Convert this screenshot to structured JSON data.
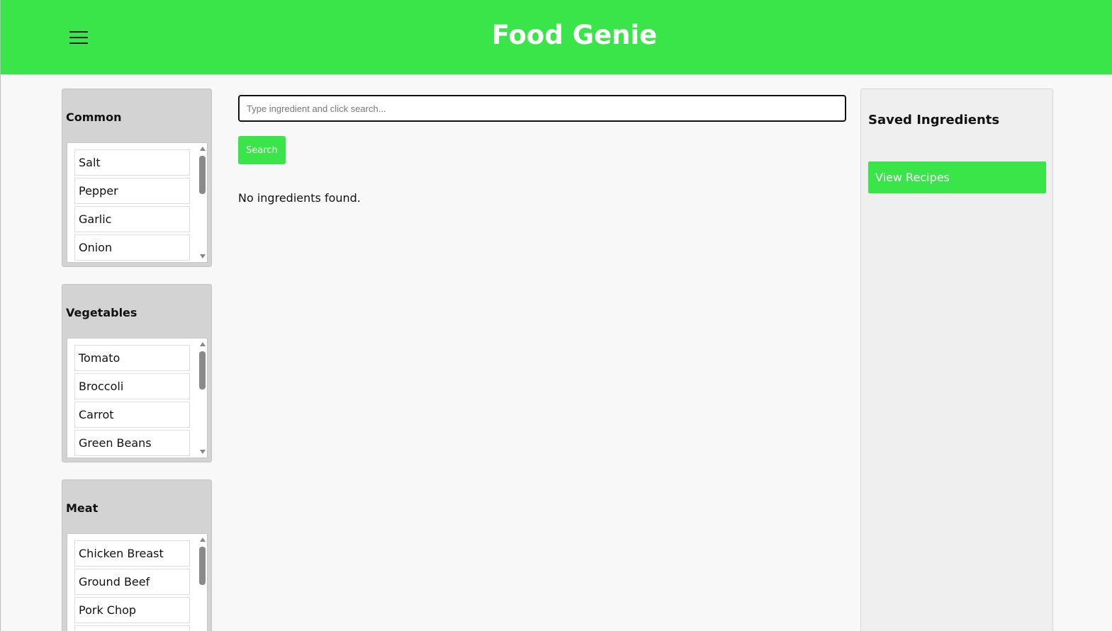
{
  "header": {
    "title": "Food Genie",
    "menu_icon": "hamburger-icon",
    "brand_color": "#3ae54a"
  },
  "categories": [
    {
      "title": "Common",
      "items": [
        "Salt",
        "Pepper",
        "Garlic",
        "Onion"
      ]
    },
    {
      "title": "Vegetables",
      "items": [
        "Tomato",
        "Broccoli",
        "Carrot",
        "Green Beans"
      ]
    },
    {
      "title": "Meat",
      "items": [
        "Chicken Breast",
        "Ground Beef",
        "Pork Chop",
        ""
      ]
    }
  ],
  "search": {
    "placeholder": "Type ingredient and click search...",
    "value": "",
    "button_label": "Search"
  },
  "results": {
    "status": "No ingredients found."
  },
  "saved": {
    "title": "Saved Ingredients",
    "button_label": "View Recipes"
  }
}
